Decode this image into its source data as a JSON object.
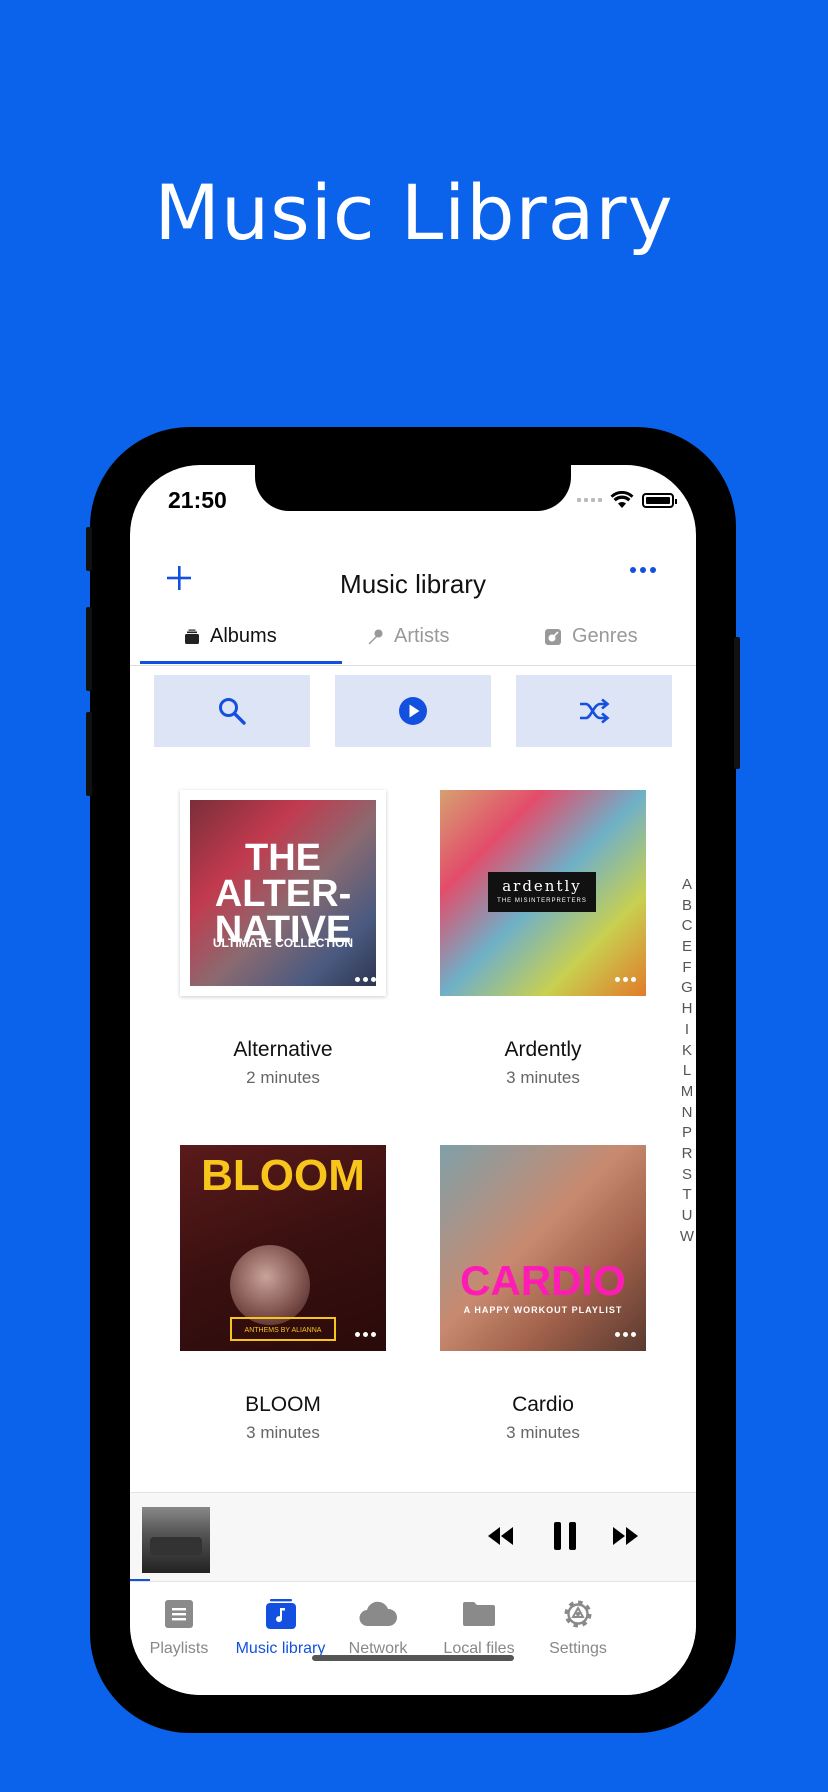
{
  "promo": {
    "title": "Music Library"
  },
  "status": {
    "time": "21:50"
  },
  "navbar": {
    "title": "Music library"
  },
  "tabs": [
    {
      "label": "Albums",
      "icon": "albums-icon"
    },
    {
      "label": "Artists",
      "icon": "microphone-icon"
    },
    {
      "label": "Genres",
      "icon": "guitar-icon"
    }
  ],
  "albums": [
    {
      "title": "Alternative",
      "duration": "2 minutes",
      "cover_text": "THE ALTER-NATIVE",
      "cover_sub": "ULTIMATE COLLECTION"
    },
    {
      "title": "Ardently",
      "duration": "3 minutes",
      "cover_text": "ardently",
      "cover_sub": "THE MISINTERPRETERS"
    },
    {
      "title": "BLOOM",
      "duration": "3 minutes",
      "cover_text": "BLOOM",
      "cover_sub": "ANTHEMS BY ALIANNA"
    },
    {
      "title": "Cardio",
      "duration": "3 minutes",
      "cover_text": "CARDIO",
      "cover_sub": "A HAPPY WORKOUT PLAYLIST"
    }
  ],
  "index_letters": [
    "A",
    "B",
    "C",
    "E",
    "F",
    "G",
    "H",
    "I",
    "K",
    "L",
    "M",
    "N",
    "P",
    "R",
    "S",
    "T",
    "U",
    "W"
  ],
  "tabbar": [
    {
      "label": "Playlists",
      "icon": "playlist-icon"
    },
    {
      "label": "Music library",
      "icon": "music-library-icon"
    },
    {
      "label": "Network",
      "icon": "cloud-icon"
    },
    {
      "label": "Local files",
      "icon": "folder-icon"
    },
    {
      "label": "Settings",
      "icon": "gear-icon"
    }
  ],
  "colors": {
    "background": "#0a63ea",
    "accent": "#1450e0"
  }
}
